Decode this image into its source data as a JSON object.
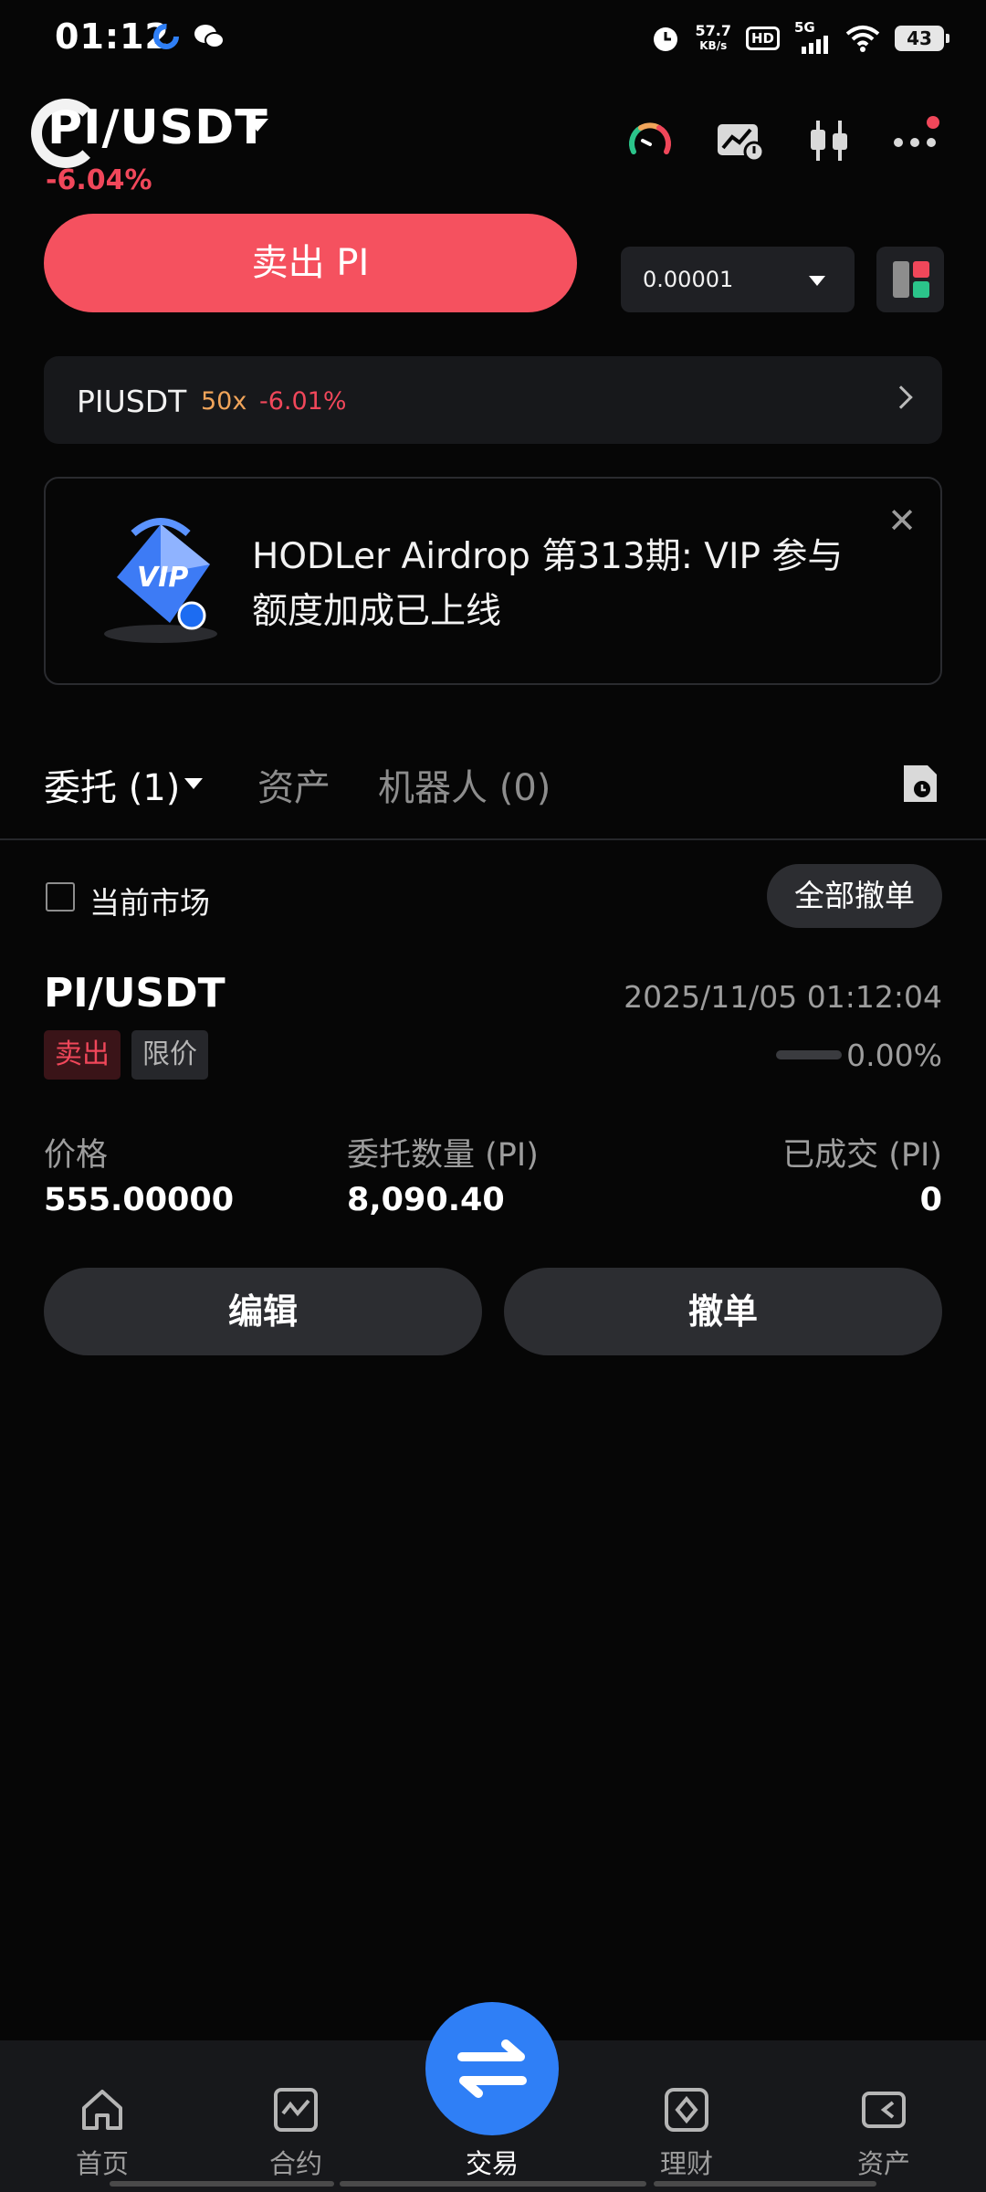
{
  "status_bar": {
    "time": "01:12",
    "net_speed_value": "57.7",
    "net_speed_unit": "KB/s",
    "hd": "HD",
    "network": "5G",
    "battery": "43"
  },
  "header": {
    "pair": "PI/USDT",
    "change": "-6.04%",
    "icons": [
      "gauge-icon",
      "chart-alert-icon",
      "candlestick-icon",
      "more-icon"
    ]
  },
  "trade": {
    "sell_label": "卖出 PI",
    "depth_value": "0.00001"
  },
  "futures": {
    "name": "PIUSDT",
    "leverage": "50x",
    "change": "-6.01%"
  },
  "banner": {
    "text": "HODLer Airdrop 第313期: VIP 参与额度加成已上线",
    "vip_art_text": "VIP"
  },
  "tabs": {
    "orders": "委托 (1)",
    "assets": "资产",
    "bots": "机器人 (0)"
  },
  "filter": {
    "current_market": "当前市场",
    "cancel_all": "全部撤单"
  },
  "order": {
    "pair": "PI/USDT",
    "time": "2025/11/05 01:12:04",
    "side": "卖出",
    "type": "限价",
    "fill_percent": "0.00%",
    "fill_fraction": 0,
    "price_label": "价格",
    "price": "555.00000",
    "amount_label": "委托数量 (PI)",
    "amount": "8,090.40",
    "filled_label": "已成交 (PI)",
    "filled": "0",
    "edit_label": "编辑",
    "cancel_label": "撤单"
  },
  "bottom_nav": {
    "home": "首页",
    "futures": "合约",
    "trade": "交易",
    "earn": "理财",
    "assets": "资产"
  },
  "colors": {
    "sell": "#f5515f",
    "negative": "#f0475a",
    "leverage": "#f0a45a",
    "accent": "#2f7ff6"
  }
}
